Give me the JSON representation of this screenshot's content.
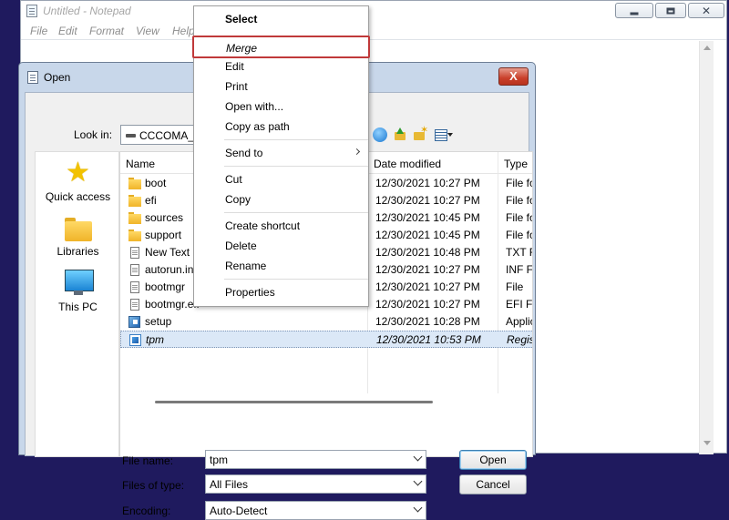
{
  "notepad": {
    "title": "Untitled - Notepad",
    "menu": [
      "File",
      "Edit",
      "Format",
      "View",
      "Help"
    ]
  },
  "dialog": {
    "title": "Open",
    "close_label": "X",
    "look_in_label": "Look in:",
    "look_in_value": "CCCOMA_X64",
    "places": [
      {
        "label": "Quick access",
        "icon": "star-icon"
      },
      {
        "label": "Libraries",
        "icon": "folder-icon"
      },
      {
        "label": "This PC",
        "icon": "monitor-icon"
      }
    ],
    "columns": {
      "name": "Name",
      "date": "Date modified",
      "type": "Type"
    },
    "files": [
      {
        "name": "boot",
        "date": "12/30/2021 10:27 PM",
        "type": "File fo",
        "icon": "folder"
      },
      {
        "name": "efi",
        "date": "12/30/2021 10:27 PM",
        "type": "File fo",
        "icon": "folder"
      },
      {
        "name": "sources",
        "date": "12/30/2021 10:45 PM",
        "type": "File fo",
        "icon": "folder"
      },
      {
        "name": "support",
        "date": "12/30/2021 10:45 PM",
        "type": "File fo",
        "icon": "folder"
      },
      {
        "name": "New Text Do",
        "date": "12/30/2021 10:48 PM",
        "type": "TXT F",
        "icon": "file"
      },
      {
        "name": "autorun.inf",
        "date": "12/30/2021 10:27 PM",
        "type": "INF F",
        "icon": "file"
      },
      {
        "name": "bootmgr",
        "date": "12/30/2021 10:27 PM",
        "type": "File",
        "icon": "file"
      },
      {
        "name": "bootmgr.efi",
        "date": "12/30/2021 10:27 PM",
        "type": "EFI Fi",
        "icon": "file"
      },
      {
        "name": "setup",
        "date": "12/30/2021 10:28 PM",
        "type": "Applic",
        "icon": "setup"
      },
      {
        "name": "tpm",
        "date": "12/30/2021 10:53 PM",
        "type": "Regis",
        "icon": "reg",
        "selected": true
      }
    ],
    "file_name_label": "File name:",
    "file_name_value": "tpm",
    "files_of_type_label": "Files of type:",
    "files_of_type_value": "All Files",
    "encoding_label": "Encoding:",
    "encoding_value": "Auto-Detect",
    "open_button": "Open",
    "cancel_button": "Cancel"
  },
  "context_menu": {
    "items": [
      {
        "label": "Select",
        "bold": true
      },
      {
        "label": "Merge",
        "highlighted": true
      },
      {
        "label": "Edit"
      },
      {
        "label": "Print"
      },
      {
        "label": "Open with..."
      },
      {
        "label": "Copy as path"
      },
      {
        "label": "Send to",
        "submenu": true
      },
      {
        "label": "Cut"
      },
      {
        "label": "Copy"
      },
      {
        "label": "Create shortcut"
      },
      {
        "label": "Delete"
      },
      {
        "label": "Rename"
      },
      {
        "label": "Properties"
      }
    ]
  },
  "colors": {
    "desktop": "#1f1a5e",
    "highlight_border": "#c0393a",
    "dialog_frame": "#c8d7ea"
  }
}
